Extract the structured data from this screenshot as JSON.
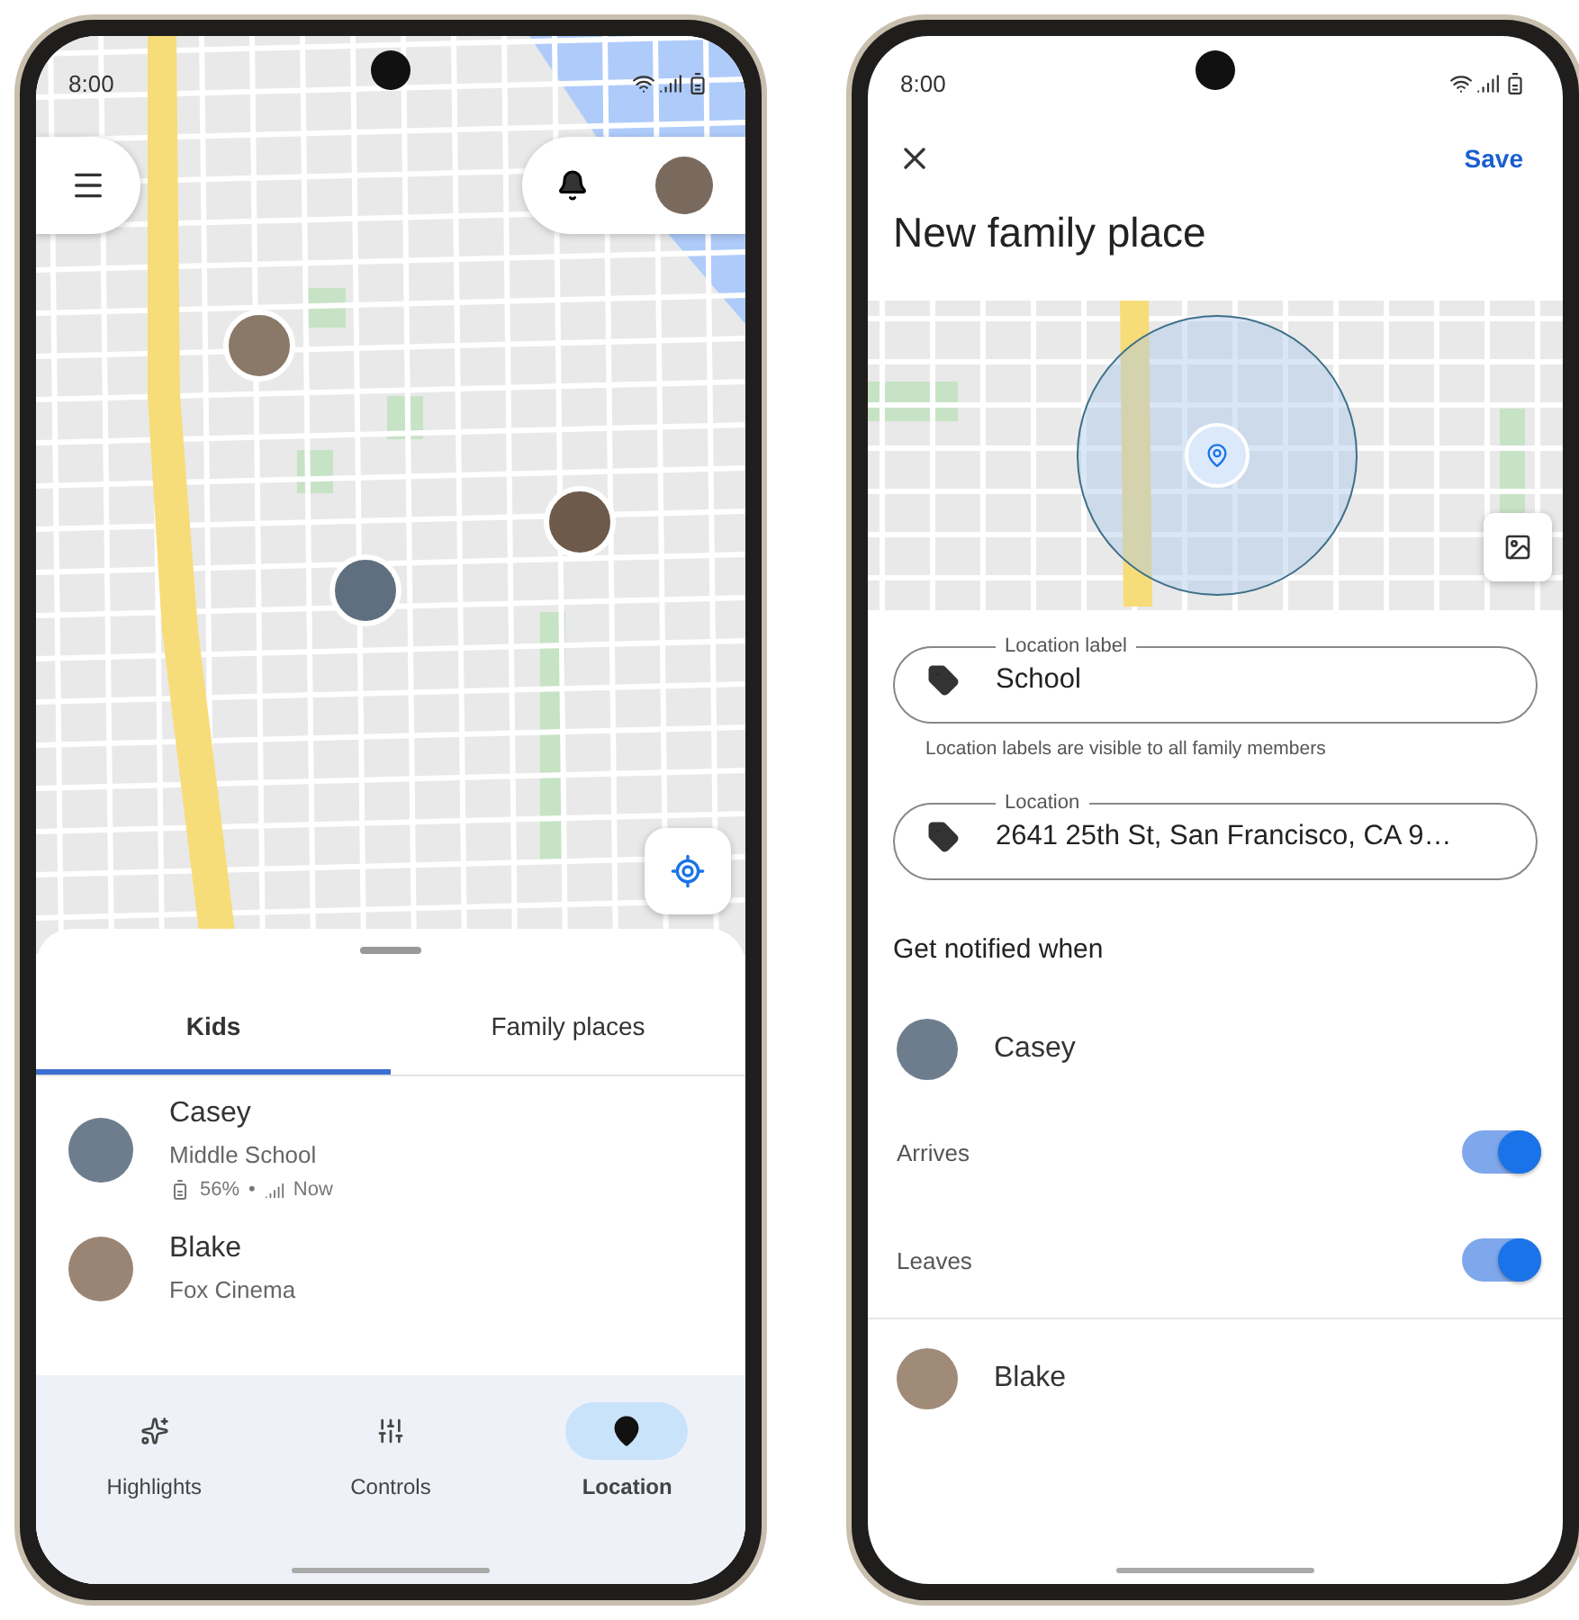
{
  "left_phone": {
    "status_bar": {
      "time": "8:00"
    },
    "tabs": [
      {
        "label": "Kids",
        "selected": true
      },
      {
        "label": "Family places",
        "selected": false
      }
    ],
    "kids": [
      {
        "name": "Casey",
        "place": "Middle School",
        "battery": "56%",
        "separator": "•",
        "updated": "Now"
      },
      {
        "name": "Blake",
        "place": "Fox Cinema"
      }
    ],
    "nav": [
      {
        "kind": "highlights",
        "label": "Highlights",
        "selected": false
      },
      {
        "kind": "controls",
        "label": "Controls",
        "selected": false
      },
      {
        "kind": "location",
        "label": "Location",
        "selected": true
      }
    ]
  },
  "right_phone": {
    "status_bar": {
      "time": "8:00"
    },
    "save": "Save",
    "title": "New family place",
    "fields": [
      {
        "label": "Location label",
        "value": "School",
        "helper": "Location labels are visible to all family members"
      },
      {
        "label": "Location",
        "value": "2641 25th St, San Francisco, CA 9…"
      }
    ],
    "notify_heading": "Get notified when",
    "members": [
      {
        "name": "Casey",
        "alerts": [
          {
            "label": "Arrives",
            "on": true
          },
          {
            "label": "Leaves",
            "on": true
          }
        ]
      },
      {
        "name": "Blake"
      }
    ]
  }
}
